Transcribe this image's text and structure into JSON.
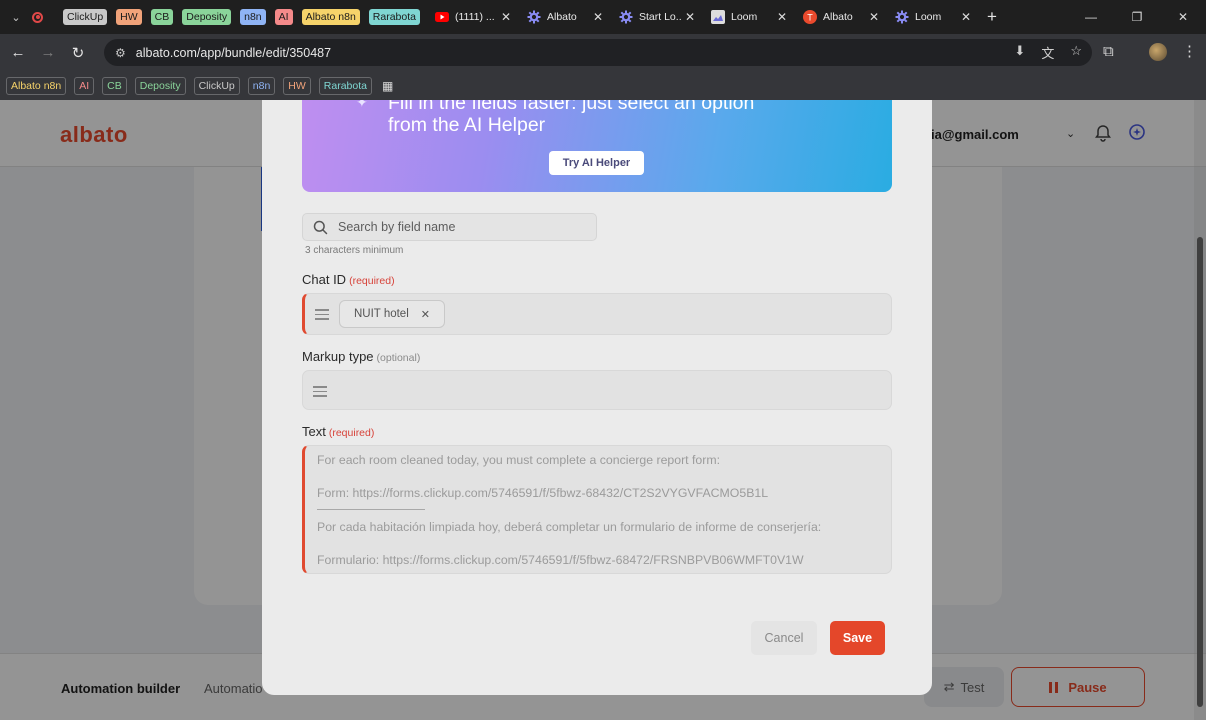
{
  "browser": {
    "tab_groups": [
      {
        "label": "ClickUp",
        "color": "#c9c9c9"
      },
      {
        "label": "HW",
        "color": "#f1a37a"
      },
      {
        "label": "CB",
        "color": "#8ad49a"
      },
      {
        "label": "Deposity",
        "color": "#8ad49a"
      },
      {
        "label": "n8n",
        "color": "#8fb4f5"
      },
      {
        "label": "AI",
        "color": "#f58a8a"
      },
      {
        "label": "Albato n8n",
        "color": "#f6d36a"
      },
      {
        "label": "Rarabota",
        "color": "#7fd6d2"
      }
    ],
    "tabs": [
      {
        "title": "(1111) ...",
        "icon": "youtube-icon"
      },
      {
        "title": "Albato",
        "icon": "albato-gear-icon"
      },
      {
        "title": "Start Lo...",
        "icon": "albato-gear-icon"
      },
      {
        "title": "Loom",
        "icon": "loom-icon"
      },
      {
        "title": "Albato",
        "icon": "albato-orange-icon"
      },
      {
        "title": "Loom",
        "icon": "albato-gear-icon"
      }
    ],
    "url": "albato.com/app/bundle/edit/350487",
    "bookmarks": [
      {
        "label": "Albato n8n",
        "color": "#f6d36a"
      },
      {
        "label": "AI",
        "color": "#f58a8a"
      },
      {
        "label": "CB",
        "color": "#8ad49a"
      },
      {
        "label": "Deposity",
        "color": "#8ad49a"
      },
      {
        "label": "ClickUp",
        "color": "#c9c9c9"
      },
      {
        "label": "n8n",
        "color": "#8fb4f5"
      },
      {
        "label": "HW",
        "color": "#f1a37a"
      },
      {
        "label": "Rarabota",
        "color": "#7fd6d2"
      }
    ]
  },
  "app": {
    "logo": "albato",
    "user_email": "lencia@gmail.com",
    "footer": {
      "tab_builder": "Automation builder",
      "tab_other": "Automatio",
      "test_label": "Test",
      "pause_label": "Pause"
    },
    "accent_color": "#ea4a2d"
  },
  "modal": {
    "ai_banner": {
      "title_line1": "Fill in the fields faster: just select an option",
      "title_line2": "from the AI Helper",
      "button": "Try AI Helper"
    },
    "search": {
      "placeholder": "Search by field name",
      "hint": "3 characters minimum"
    },
    "fields": {
      "chat_id": {
        "label": "Chat ID",
        "tag": "(required)",
        "chip": "NUIT hotel"
      },
      "markup_type": {
        "label": "Markup type",
        "tag": "(optional)"
      },
      "text": {
        "label": "Text",
        "tag": "(required)",
        "lines": [
          "For each room cleaned today, you must complete a concierge report form:",
          "Form: https://forms.clickup.com/5746591/f/5fbwz-68432/CT2S2VYGVFACMO5B1L",
          "Por cada habitación limpiada hoy, deberá completar un formulario de informe de conserjería:",
          "Formulario: https://forms.clickup.com/5746591/f/5fbwz-68472/FRSNBPVB06WMFT0V1W"
        ]
      }
    },
    "cancel_label": "Cancel",
    "save_label": "Save"
  }
}
